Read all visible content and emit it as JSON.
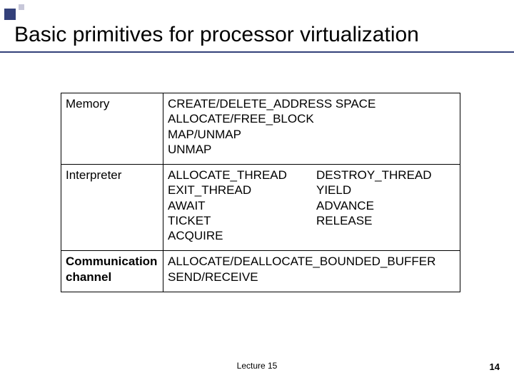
{
  "title": "Basic primitives for processor virtualization",
  "rows": {
    "memory": {
      "label": "Memory",
      "lines": [
        "CREATE/DELETE_ADDRESS SPACE",
        "ALLOCATE/FREE_BLOCK",
        "MAP/UNMAP",
        "UNMAP"
      ]
    },
    "interpreter": {
      "label": "Interpreter",
      "left": [
        "ALLOCATE_THREAD",
        "EXIT_THREAD",
        "AWAIT",
        "TICKET",
        "ACQUIRE"
      ],
      "right": [
        "DESTROY_THREAD",
        "YIELD",
        " ADVANCE",
        "",
        "RELEASE"
      ]
    },
    "comm": {
      "label1": "Communication",
      "label2": "channel",
      "lines": [
        "ALLOCATE/DEALLOCATE_BOUNDED_BUFFER",
        "SEND/RECEIVE"
      ]
    }
  },
  "footer": {
    "center": "Lecture 15",
    "page": "14"
  }
}
